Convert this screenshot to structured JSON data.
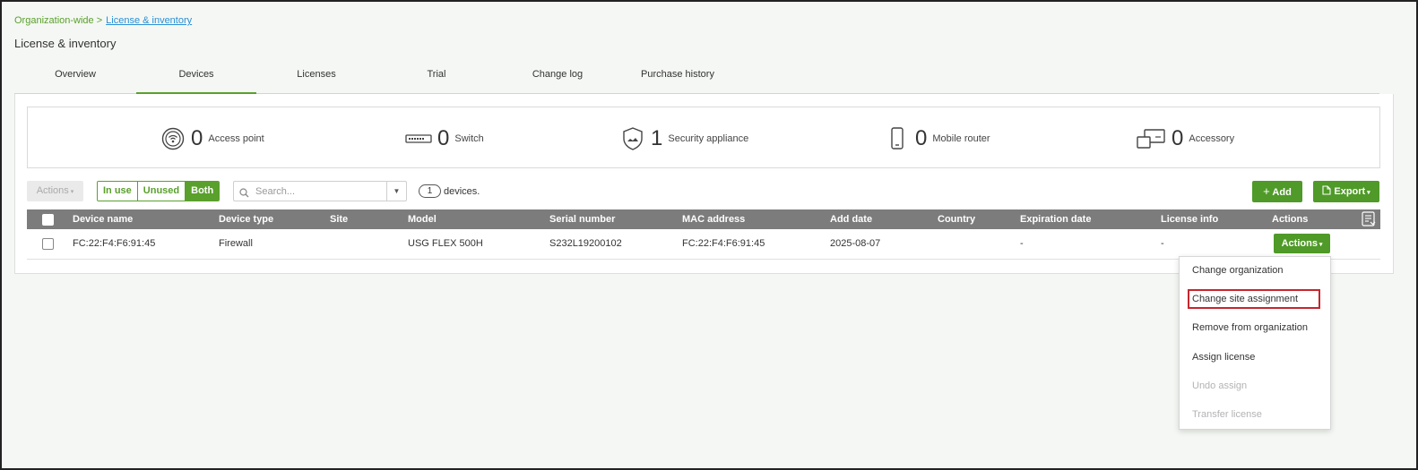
{
  "breadcrumb": {
    "root": "Organization-wide >",
    "current": "License & inventory"
  },
  "page_title": "License & inventory",
  "tabs": [
    {
      "label": "Overview"
    },
    {
      "label": "Devices"
    },
    {
      "label": "Licenses"
    },
    {
      "label": "Trial"
    },
    {
      "label": "Change log"
    },
    {
      "label": "Purchase history"
    }
  ],
  "active_tab": "Devices",
  "summary": [
    {
      "icon": "access-point-icon",
      "count": "0",
      "label": "Access point"
    },
    {
      "icon": "switch-icon",
      "count": "0",
      "label": "Switch"
    },
    {
      "icon": "security-appliance-icon",
      "count": "1",
      "label": "Security appliance"
    },
    {
      "icon": "mobile-router-icon",
      "count": "0",
      "label": "Mobile router"
    },
    {
      "icon": "accessory-icon",
      "count": "0",
      "label": "Accessory"
    }
  ],
  "toolbar": {
    "actions_label": "Actions",
    "filter": [
      "In use",
      "Unused",
      "Both"
    ],
    "filter_selected": "Both",
    "search_placeholder": "Search...",
    "device_count": "1",
    "device_count_label": "devices.",
    "add_label": "Add",
    "export_label": "Export"
  },
  "table": {
    "columns": [
      "Device name",
      "Device type",
      "Site",
      "Model",
      "Serial number",
      "MAC address",
      "Add date",
      "Country",
      "Expiration date",
      "License info",
      "Actions"
    ],
    "rows": [
      {
        "device_name": "FC:22:F4:F6:91:45",
        "device_type": "Firewall",
        "site": "",
        "model": "USG FLEX 500H",
        "serial": "S232L19200102",
        "mac": "FC:22:F4:F6:91:45",
        "add_date": "2025-08-07",
        "country": "",
        "expiration": "-",
        "license_info": "-",
        "actions_label": "Actions"
      }
    ]
  },
  "actions_menu": [
    {
      "label": "Change organization",
      "enabled": true
    },
    {
      "label": "Change site assignment",
      "enabled": true,
      "highlighted": true
    },
    {
      "label": "Remove from organization",
      "enabled": true
    },
    {
      "label": "Assign license",
      "enabled": true
    },
    {
      "label": "Undo assign",
      "enabled": false
    },
    {
      "label": "Transfer license",
      "enabled": false
    }
  ],
  "colors": {
    "accent": "#5aa02c",
    "button": "#4f9a28",
    "header": "#7c7c7c",
    "highlight": "#c6262e"
  }
}
